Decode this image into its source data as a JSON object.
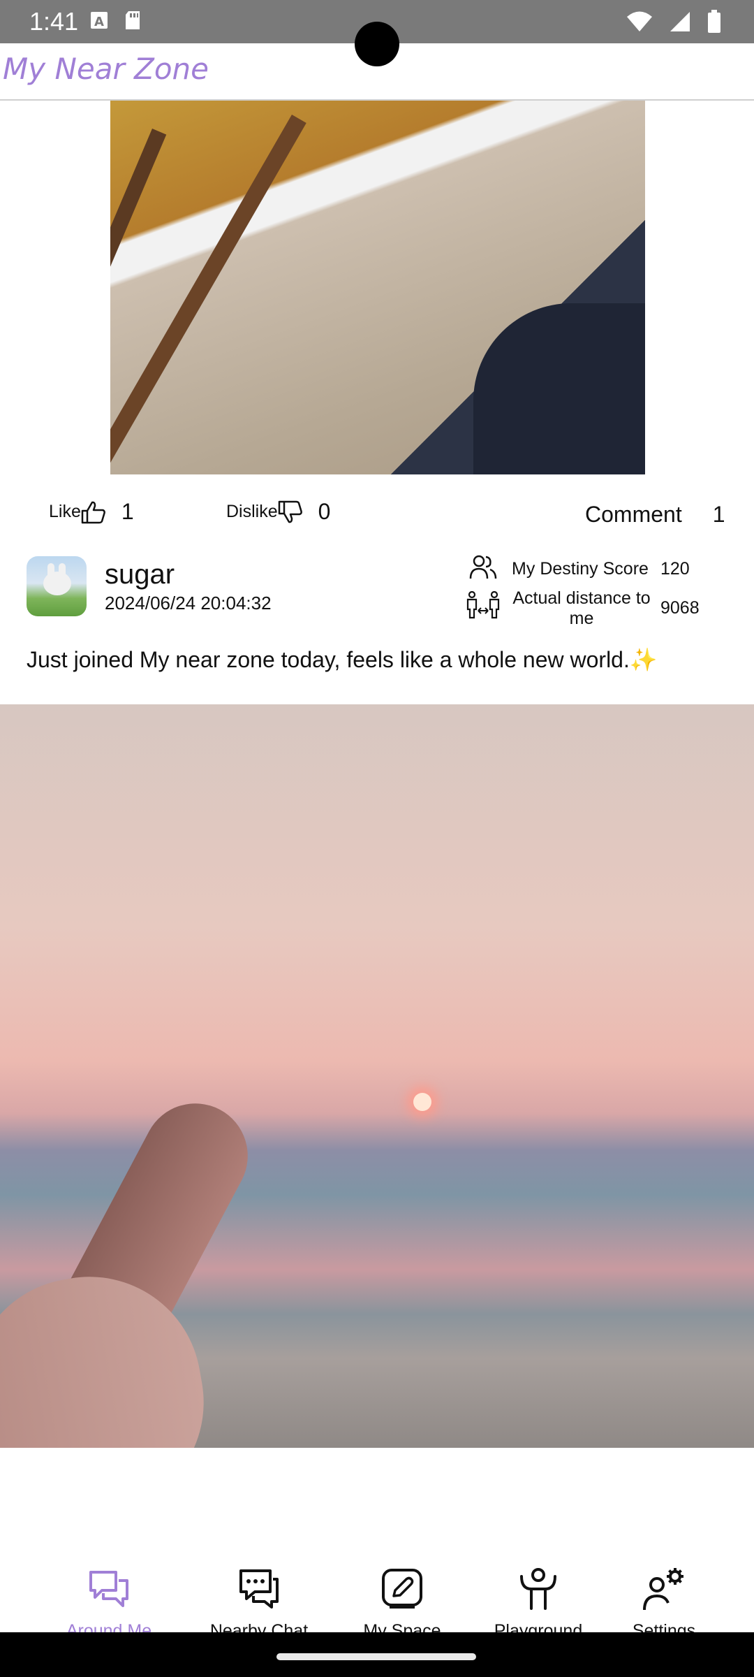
{
  "status_bar": {
    "time": "1:41"
  },
  "app_bar": {
    "title": "My Near Zone"
  },
  "post_prev": {
    "like_label": "Like",
    "like_count": "1",
    "dislike_label": "Dislike",
    "dislike_count": "0",
    "comment_label": "Comment",
    "comment_count": "1"
  },
  "post": {
    "username": "sugar",
    "timestamp": "2024/06/24 20:04:32",
    "destiny_label": "My Destiny Score",
    "destiny_value": "120",
    "distance_label": "Actual distance to me",
    "distance_value": "9068",
    "text": "Just joined My near zone today, feels like a whole new world.✨"
  },
  "bottom_nav": {
    "items": [
      {
        "label": "Around Me",
        "icon": "chat-bubbles-icon",
        "active": true
      },
      {
        "label": "Nearby Chat",
        "icon": "message-dots-icon",
        "active": false
      },
      {
        "label": "My Space",
        "icon": "edit-icon",
        "active": false
      },
      {
        "label": "Playground",
        "icon": "person-arms-up-icon",
        "active": false
      },
      {
        "label": "Settings",
        "icon": "user-gear-icon",
        "active": false
      }
    ]
  },
  "colors": {
    "accent": "#a07fd6",
    "status_bar": "#7a7a7a"
  }
}
